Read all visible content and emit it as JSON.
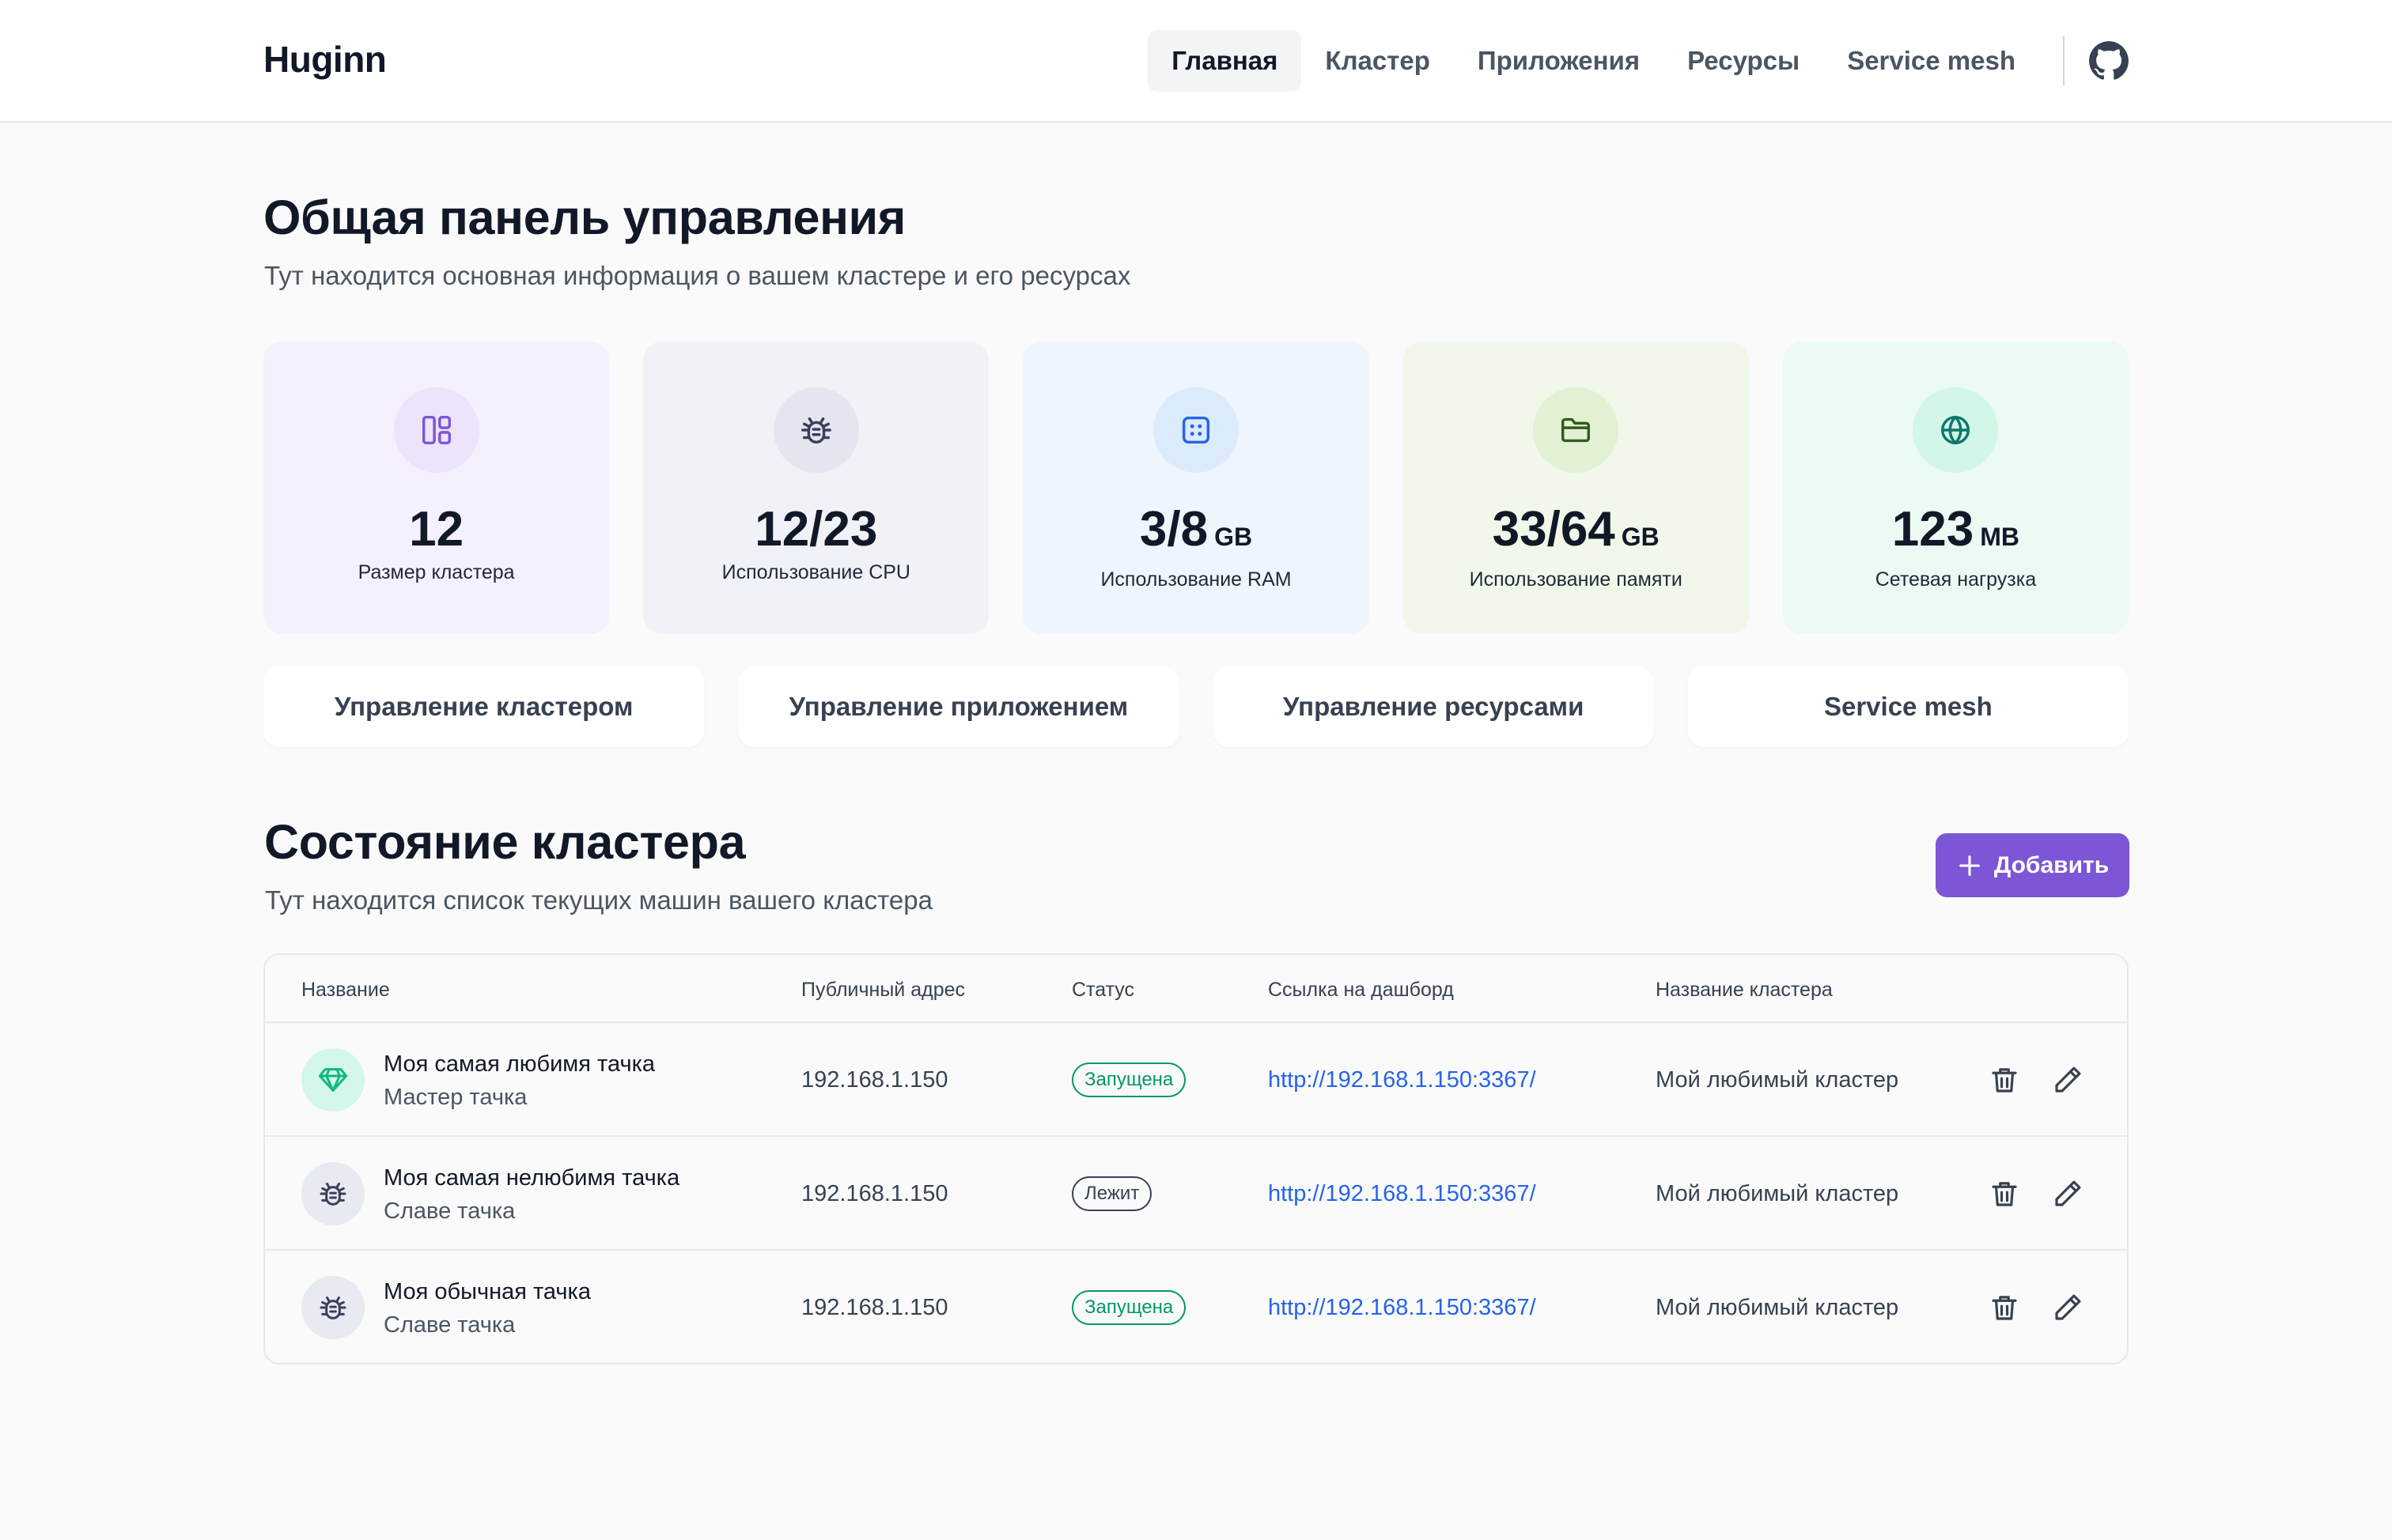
{
  "app": {
    "logo": "Huginn"
  },
  "nav": {
    "items": [
      {
        "label": "Главная",
        "active": true
      },
      {
        "label": "Кластер",
        "active": false
      },
      {
        "label": "Приложения",
        "active": false
      },
      {
        "label": "Ресурсы",
        "active": false
      },
      {
        "label": "Service mesh",
        "active": false
      }
    ],
    "github_icon": "github-icon"
  },
  "overview": {
    "title": "Общая панель управления",
    "subtitle": "Тут находится основная информация о вашем кластере и его ресурсах",
    "cards": [
      {
        "value": "12",
        "unit": "",
        "label": "Размер кластера",
        "icon": "layout-icon",
        "bg": "#f5f0fd",
        "icon_bg": "#ede3fb",
        "icon_color": "#7c56d6"
      },
      {
        "value": "12/23",
        "unit": "",
        "label": "Использование CPU",
        "icon": "bug-icon",
        "bg": "#f1f2f7",
        "icon_bg": "#e4e6ef",
        "icon_color": "#3b3f5c"
      },
      {
        "value": "3/8",
        "unit": "GB",
        "label": "Использование RAM",
        "icon": "chip-icon",
        "bg": "#eef5fd",
        "icon_bg": "#dcebfb",
        "icon_color": "#2563eb"
      },
      {
        "value": "33/64",
        "unit": "GB",
        "label": "Использование памяти",
        "icon": "folder-icon",
        "bg": "#f1f8ea",
        "icon_bg": "#e2f1d4",
        "icon_color": "#2f5d1c"
      },
      {
        "value": "123",
        "unit": "MB",
        "label": "Сетевая нагрузка",
        "icon": "globe-icon",
        "bg": "#ebfbf4",
        "icon_bg": "#d2f6e7",
        "icon_color": "#0f766e"
      }
    ]
  },
  "actions": [
    {
      "label": "Управление кластером"
    },
    {
      "label": "Управление приложением"
    },
    {
      "label": "Управление ресурсами"
    },
    {
      "label": "Service mesh"
    }
  ],
  "cluster": {
    "title": "Состояние кластера",
    "subtitle": "Тут находится список текущих машин вашего кластера",
    "add_label": "Добавить",
    "columns": [
      "Название",
      "Публичный адрес",
      "Статус",
      "Ссылка на дашборд",
      "Название кластера"
    ],
    "rows": [
      {
        "name": "Моя самая любимя тачка",
        "role": "Мастер тачка",
        "ip": "192.168.1.150",
        "status": "Запущена",
        "status_kind": "ok",
        "link": "http://192.168.1.150:3367/",
        "cluster": "Мой любимый кластер",
        "icon": "diamond-icon"
      },
      {
        "name": "Моя самая нелюбимя тачка",
        "role": "Славе тачка",
        "ip": "192.168.1.150",
        "status": "Лежит",
        "status_kind": "down",
        "link": "http://192.168.1.150:3367/",
        "cluster": "Мой любимый кластер",
        "icon": "bug-icon"
      },
      {
        "name": "Моя обычная тачка",
        "role": "Славе тачка",
        "ip": "192.168.1.150",
        "status": "Запущена",
        "status_kind": "ok",
        "link": "http://192.168.1.150:3367/",
        "cluster": "Мой любимый кластер",
        "icon": "bug-icon"
      }
    ],
    "row_actions": [
      "trash-icon",
      "pencil-icon"
    ]
  }
}
